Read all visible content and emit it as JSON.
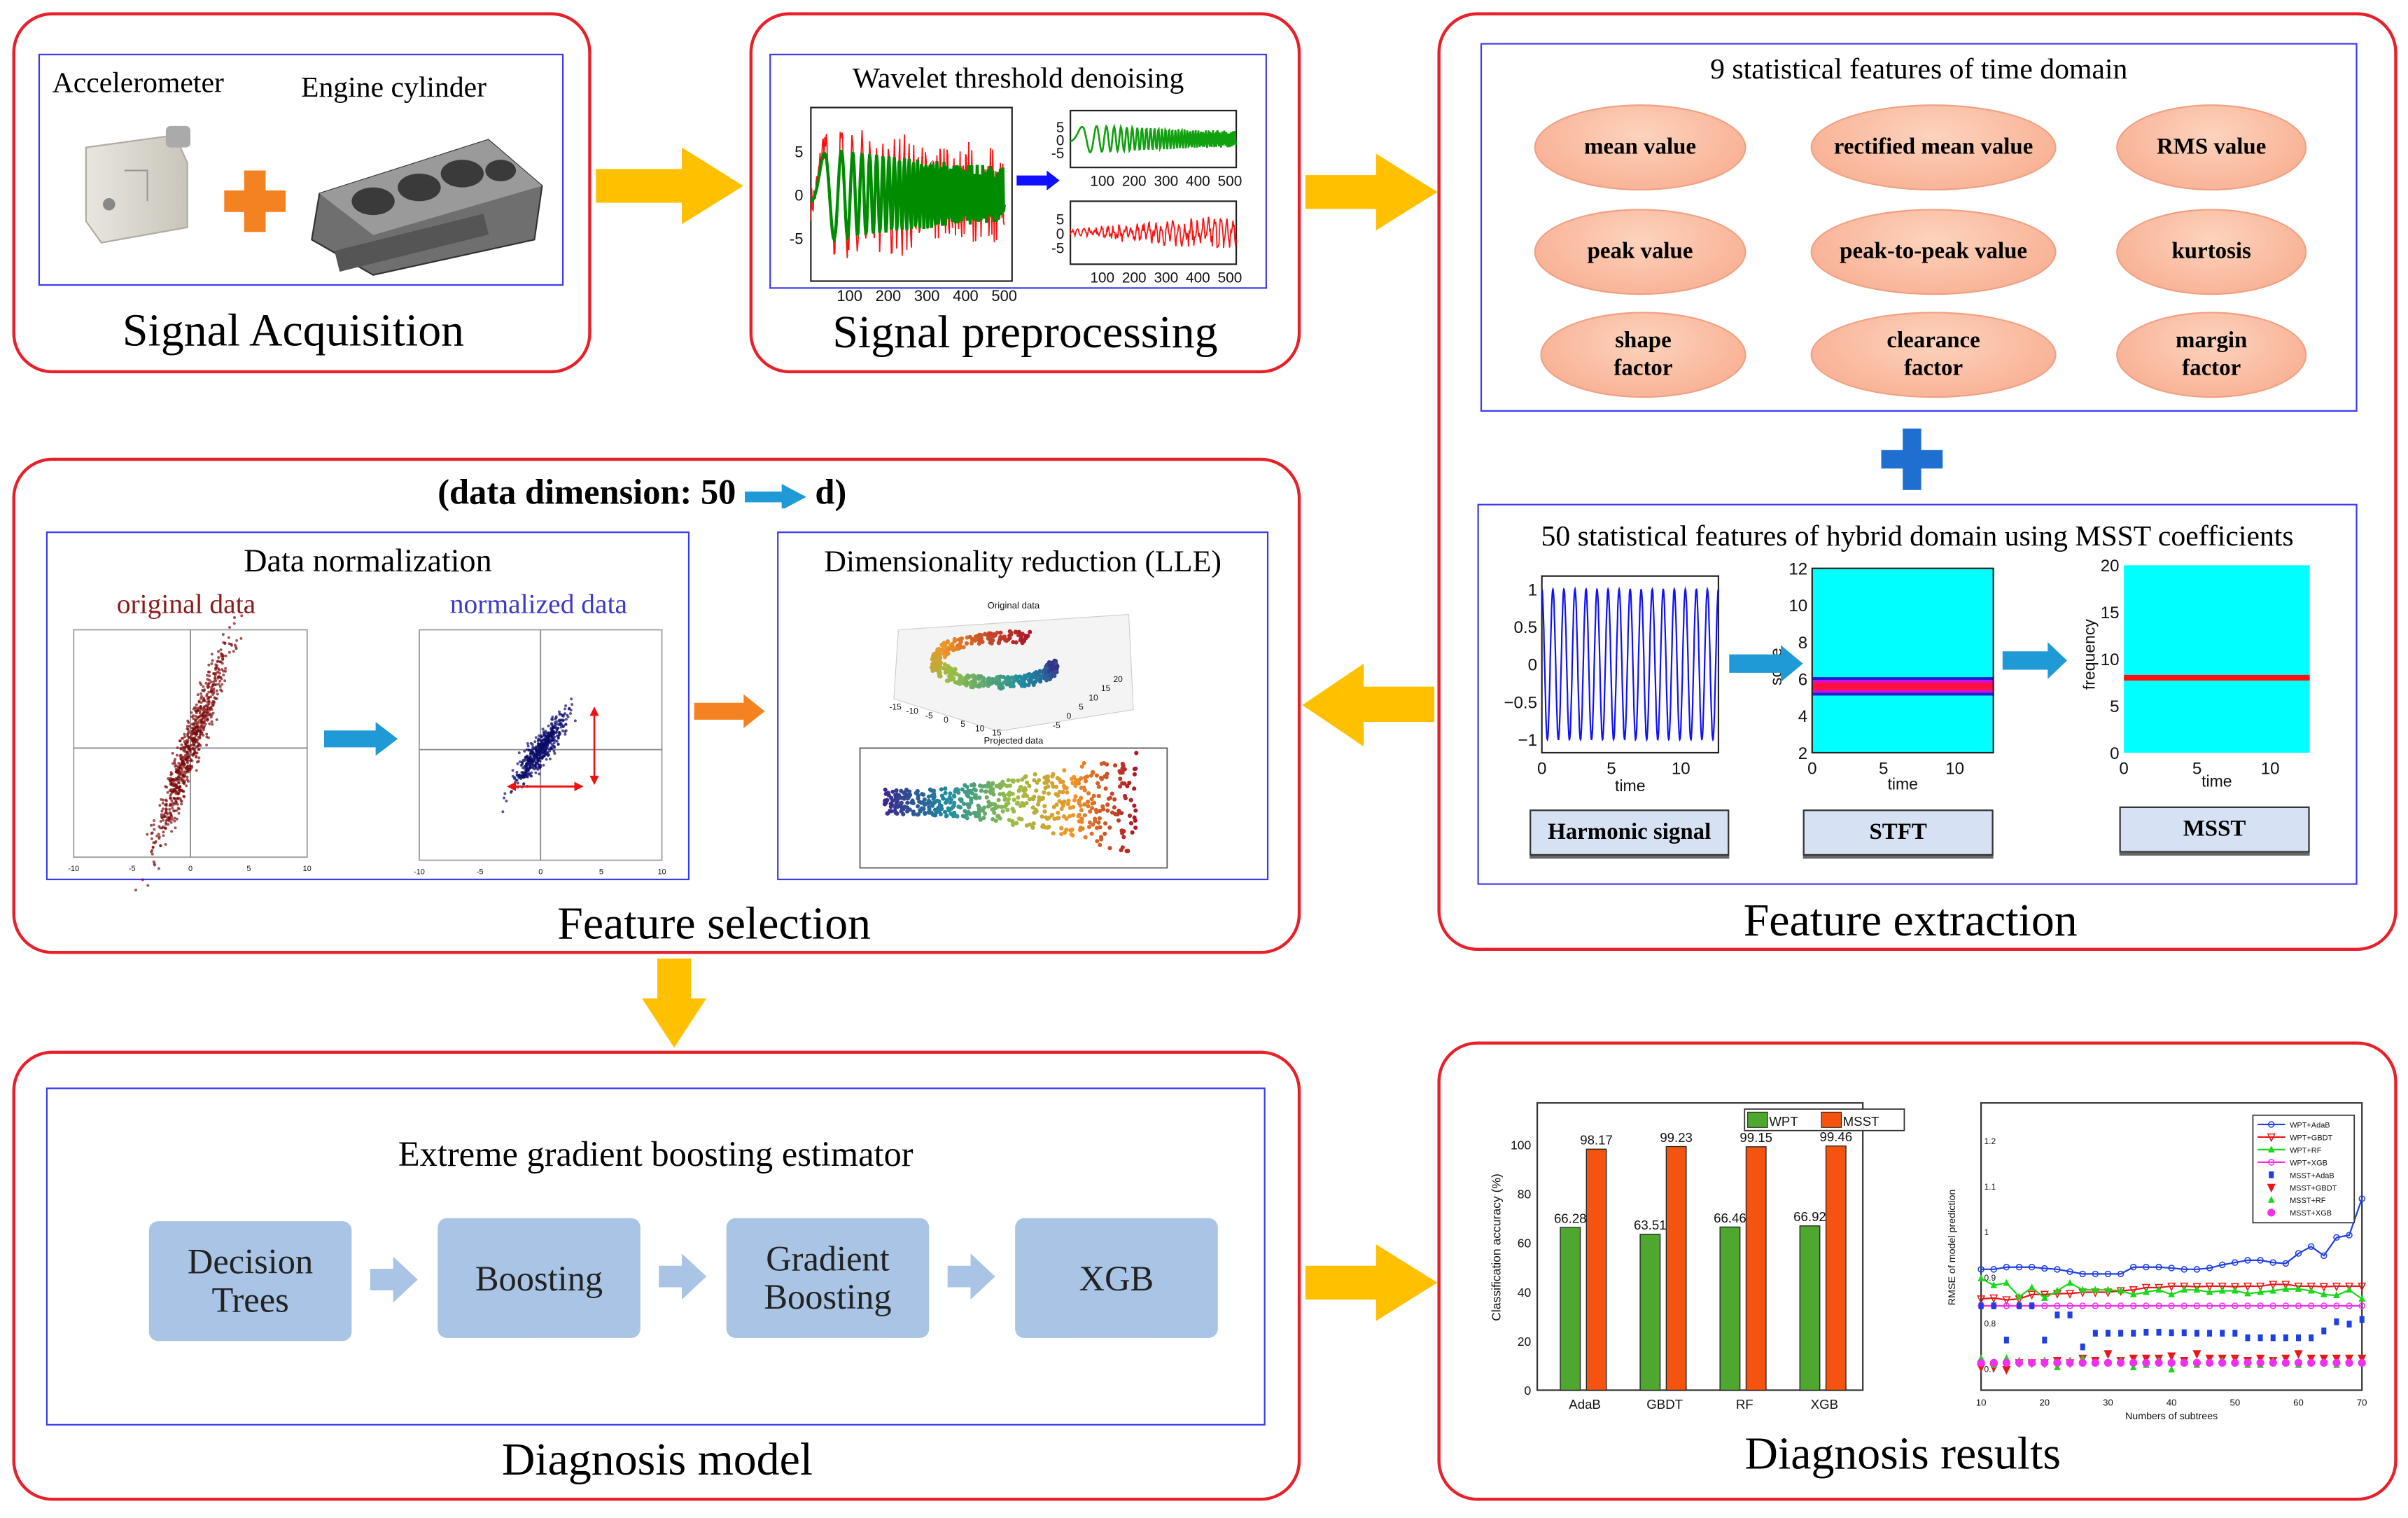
{
  "colors": {
    "stage_border": "#e8202a",
    "inner_border": "#3a3af0",
    "flow_arrow": "#ffc000",
    "blue_arrow": "#1f9ad6",
    "orange_arrow": "#f58220",
    "ellipse": "#f7a88a",
    "flow_box": "#a9c4e4"
  },
  "acquisition": {
    "title": "Signal Acquisition",
    "sensor_label": "Accelerometer",
    "engine_label": "Engine cylinder",
    "icons": [
      "accelerometer-image",
      "plus-icon",
      "engine-cylinder-image"
    ]
  },
  "preprocessing": {
    "title": "Signal preprocessing",
    "subtitle": "Wavelet threshold denoising",
    "main_plot": {
      "xticks": [
        "100",
        "200",
        "300",
        "400",
        "500"
      ],
      "yticks": [
        "5",
        "0",
        "-5"
      ]
    },
    "denoised_plot": {
      "xticks": [
        "100",
        "200",
        "300",
        "400",
        "500"
      ],
      "yticks": [
        "5",
        "0",
        "-5"
      ]
    },
    "noise_plot": {
      "xticks": [
        "100",
        "200",
        "300",
        "400",
        "500"
      ],
      "yticks": [
        "5",
        "0",
        "-5"
      ]
    }
  },
  "extraction": {
    "title": "Feature extraction",
    "time_domain_title": "9 statistical features of time domain",
    "features": [
      "mean value",
      "rectified mean value",
      "RMS value",
      "peak value",
      "peak-to-peak value",
      "kurtosis",
      "shape factor",
      "clearance factor",
      "margin factor"
    ],
    "hybrid_title": "50 statistical features of  hybrid domain using MSST coefficients",
    "harmonic": {
      "label": "Harmonic signal",
      "xlabel": "time",
      "xticks": [
        "0",
        "5",
        "10"
      ],
      "yticks": [
        "1",
        "0.5",
        "0",
        "−0.5",
        "−1"
      ]
    },
    "stft": {
      "label": "STFT",
      "xlabel": "time",
      "ylabel": "scale",
      "xticks": [
        "0",
        "5",
        "10"
      ],
      "yticks": [
        "12",
        "10",
        "8",
        "6",
        "4",
        "2"
      ]
    },
    "msst": {
      "label": "MSST",
      "xlabel": "time",
      "ylabel": "frequency",
      "xticks": [
        "0",
        "5",
        "10"
      ],
      "yticks": [
        "20",
        "15",
        "10",
        "5",
        "0"
      ]
    }
  },
  "selection": {
    "title": "Feature selection",
    "dimension_prefix": "(data dimension: 50",
    "dimension_suffix": "d)",
    "normalization_title": "Data normalization",
    "original_label": "original data",
    "normalized_label": "normalized data",
    "scatter_ticks": [
      "-10",
      "-5",
      "0",
      "5",
      "10"
    ],
    "lle_title": "Dimensionality reduction (LLE)",
    "lle_original_caption": "Original data",
    "lle_projected_caption": "Projected data",
    "lle_x_ticks": [
      "-15",
      "-10",
      "-5",
      "0",
      "5",
      "10",
      "15"
    ],
    "lle_y_ticks": [
      "-5",
      "0",
      "5",
      "10",
      "15",
      "20"
    ]
  },
  "model": {
    "title": "Diagnosis model",
    "subtitle": "Extreme gradient boosting estimator",
    "steps": [
      "Decision Trees",
      "Boosting",
      "Gradient Boosting",
      "XGB"
    ]
  },
  "results": {
    "title": "Diagnosis results"
  },
  "chart_data": [
    {
      "type": "bar",
      "ylabel": "Classification accuracy (%)",
      "categories": [
        "AdaB",
        "GBDT",
        "RF",
        "XGB"
      ],
      "series": [
        {
          "name": "WPT",
          "color": "#4ea72e",
          "values": [
            66.28,
            63.51,
            66.46,
            66.92
          ]
        },
        {
          "name": "MSST",
          "color": "#f4540f",
          "values": [
            98.17,
            99.23,
            99.15,
            99.46
          ]
        }
      ],
      "ylim": [
        0,
        117
      ],
      "yticks": [
        0,
        20,
        40,
        60,
        80,
        100
      ],
      "legend": "top-right",
      "data_labels": true
    },
    {
      "type": "line",
      "xlabel": "Numbers of subtrees",
      "ylabel": "RMSE of model prediction",
      "xlim": [
        10,
        70
      ],
      "ylim": [
        0.65,
        1.28
      ],
      "xticks": [
        10,
        20,
        30,
        40,
        50,
        60,
        70
      ],
      "yticks": [
        0.7,
        0.8,
        0.9,
        1,
        1.1,
        1.2
      ],
      "legend": "top-right",
      "x": [
        10,
        12,
        14,
        16,
        18,
        20,
        22,
        24,
        26,
        28,
        30,
        32,
        34,
        36,
        38,
        40,
        42,
        44,
        46,
        48,
        50,
        52,
        54,
        56,
        58,
        60,
        62,
        64,
        66,
        68,
        70
      ],
      "series": [
        {
          "name": "WPT+AdaB",
          "color": "#1f3fe0",
          "style": "line-circle",
          "values": [
            0.915,
            0.915,
            0.92,
            0.92,
            0.92,
            0.917,
            0.915,
            0.91,
            0.905,
            0.905,
            0.905,
            0.905,
            0.92,
            0.92,
            0.92,
            0.918,
            0.915,
            0.915,
            0.918,
            0.925,
            0.93,
            0.935,
            0.935,
            0.93,
            0.928,
            0.95,
            0.965,
            0.945,
            0.985,
            0.99,
            1.07
          ]
        },
        {
          "name": "WPT+GBDT",
          "color": "#e81818",
          "style": "line-triangle",
          "values": [
            0.85,
            0.852,
            0.848,
            0.85,
            0.86,
            0.86,
            0.862,
            0.862,
            0.865,
            0.865,
            0.865,
            0.868,
            0.87,
            0.875,
            0.875,
            0.878,
            0.878,
            0.877,
            0.878,
            0.878,
            0.877,
            0.878,
            0.878,
            0.882,
            0.882,
            0.878,
            0.878,
            0.877,
            0.878,
            0.878,
            0.878
          ]
        },
        {
          "name": "WPT+RF",
          "color": "#18d818",
          "style": "line-star",
          "values": [
            0.895,
            0.88,
            0.885,
            0.855,
            0.875,
            0.852,
            0.868,
            0.885,
            0.87,
            0.87,
            0.87,
            0.868,
            0.86,
            0.865,
            0.87,
            0.86,
            0.87,
            0.87,
            0.865,
            0.868,
            0.868,
            0.862,
            0.865,
            0.868,
            0.872,
            0.872,
            0.868,
            0.86,
            0.858,
            0.87,
            0.85
          ]
        },
        {
          "name": "WPT+XGB",
          "color": "#f030f0",
          "style": "line-circle",
          "values": [
            0.835,
            0.835,
            0.835,
            0.835,
            0.835,
            0.835,
            0.835,
            0.835,
            0.835,
            0.835,
            0.835,
            0.835,
            0.835,
            0.835,
            0.835,
            0.835,
            0.835,
            0.835,
            0.835,
            0.835,
            0.835,
            0.835,
            0.835,
            0.835,
            0.835,
            0.835,
            0.835,
            0.835,
            0.835,
            0.835,
            0.835
          ]
        },
        {
          "name": "MSST+AdaB",
          "color": "#1f3fe0",
          "style": "square",
          "values": [
            0.835,
            0.835,
            0.76,
            0.835,
            0.835,
            0.76,
            0.815,
            0.815,
            0.745,
            0.775,
            0.775,
            0.775,
            0.775,
            0.777,
            0.777,
            0.776,
            0.776,
            0.775,
            0.775,
            0.775,
            0.775,
            0.765,
            0.765,
            0.765,
            0.765,
            0.765,
            0.765,
            0.78,
            0.8,
            0.795,
            0.805
          ]
        },
        {
          "name": "MSST+GBDT",
          "color": "#e81818",
          "style": "triangle",
          "values": [
            0.7,
            0.7,
            0.695,
            0.71,
            0.71,
            0.71,
            0.715,
            0.71,
            0.72,
            0.715,
            0.73,
            0.715,
            0.72,
            0.72,
            0.72,
            0.725,
            0.715,
            0.73,
            0.72,
            0.72,
            0.72,
            0.715,
            0.72,
            0.715,
            0.72,
            0.73,
            0.72,
            0.72,
            0.72,
            0.72,
            0.72
          ]
        },
        {
          "name": "MSST+RF",
          "color": "#18d818",
          "style": "star",
          "values": [
            0.72,
            0.705,
            0.72,
            0.715,
            0.71,
            0.715,
            0.7,
            0.715,
            0.72,
            0.71,
            0.71,
            0.715,
            0.7,
            0.705,
            0.715,
            0.695,
            0.71,
            0.705,
            0.71,
            0.715,
            0.71,
            0.705,
            0.705,
            0.715,
            0.71,
            0.705,
            0.71,
            0.71,
            0.705,
            0.71,
            0.71
          ]
        },
        {
          "name": "MSST+XGB",
          "color": "#f030f0",
          "style": "circle",
          "values": [
            0.71,
            0.71,
            0.71,
            0.71,
            0.71,
            0.71,
            0.71,
            0.71,
            0.71,
            0.71,
            0.71,
            0.71,
            0.71,
            0.71,
            0.71,
            0.71,
            0.71,
            0.71,
            0.71,
            0.71,
            0.71,
            0.71,
            0.71,
            0.71,
            0.71,
            0.71,
            0.71,
            0.71,
            0.71,
            0.71,
            0.71
          ]
        }
      ]
    }
  ]
}
